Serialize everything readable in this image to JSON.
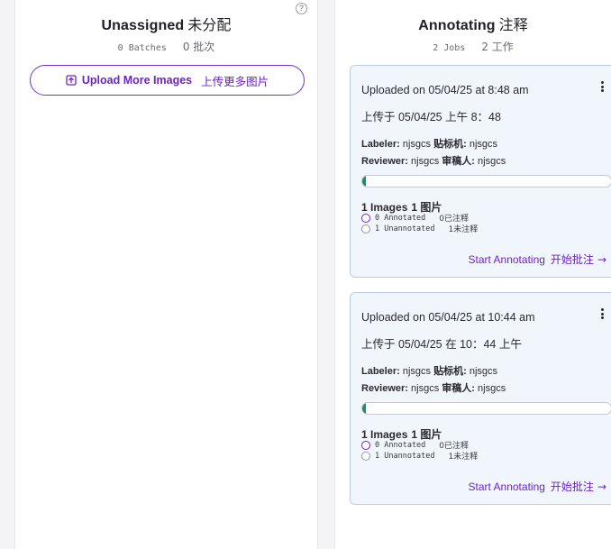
{
  "unassigned": {
    "title": "Unassigned",
    "title_cn": "未分配",
    "batches_count": "0 Batches",
    "batches_cn": "0 批次",
    "help_icon": "?",
    "upload_label": "Upload More Images",
    "upload_label_cn": "上传更多图片"
  },
  "annotating": {
    "title": "Annotating",
    "title_cn": "注释",
    "jobs_count": "2 Jobs",
    "jobs_cn": "2 工作",
    "jobs": [
      {
        "uploaded": "Uploaded on 05/04/25 at 8:48 am",
        "uploaded_cn": "上传于 05/04/25 上午 8：48",
        "labeler_key": "Labeler:",
        "labeler_val": "njsgcs",
        "labeler_cn_key": "贴标机:",
        "labeler_cn_val": "njsgcs",
        "reviewer_key": "Reviewer:",
        "reviewer_val": "njsgcs",
        "reviewer_cn_key": "审稿人:",
        "reviewer_cn_val": "njsgcs",
        "progress": 0.01,
        "images": "1 Images",
        "images_cn": "1 图片",
        "annotated": "0 Annotated",
        "annotated_cn": "0已注释",
        "unannotated": "1 Unannotated",
        "unannotated_cn": "1未注释",
        "start": "Start Annotating",
        "start_cn": "开始批注",
        "arrow": "→"
      },
      {
        "uploaded": "Uploaded on 05/04/25 at 10:44 am",
        "uploaded_cn": "上传于 05/04/25 在 10：44 上午",
        "labeler_key": "Labeler:",
        "labeler_val": "njsgcs",
        "labeler_cn_key": "贴标机:",
        "labeler_cn_val": "njsgcs",
        "reviewer_key": "Reviewer:",
        "reviewer_val": "njsgcs",
        "reviewer_cn_key": "审稿人:",
        "reviewer_cn_val": "njsgcs",
        "progress": 0.01,
        "images": "1 Images",
        "images_cn": "1 图片",
        "annotated": "0 Annotated",
        "annotated_cn": "0已注释",
        "unannotated": "1 Unannotated",
        "unannotated_cn": "1未注释",
        "start": "Start Annotating",
        "start_cn": "开始批注",
        "arrow": "→"
      }
    ]
  },
  "colors": {
    "accent": "#6a25c4",
    "card_bg": "#f1f6fd",
    "card_border": "#b8cdec",
    "progress_fill": "#1f8f5a"
  },
  "icons": {
    "upload": "upload-icon",
    "help": "help-circle-icon",
    "menu": "kebab-menu-icon",
    "arrow": "arrow-right-icon"
  }
}
